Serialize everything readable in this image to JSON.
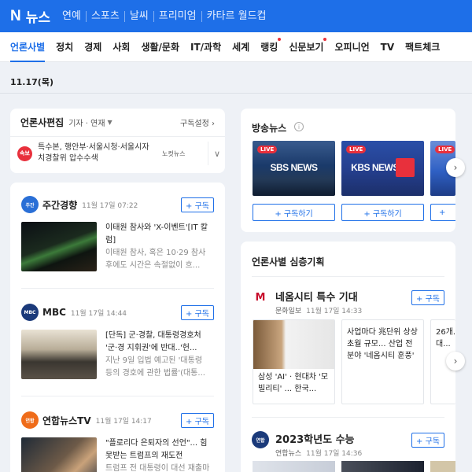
{
  "header": {
    "logo_letter": "N",
    "logo_text": "뉴스",
    "nav": [
      "연예",
      "스포츠",
      "날씨",
      "프리미엄",
      "카타르 월드컵"
    ]
  },
  "categories": [
    {
      "label": "언론사별",
      "active": true
    },
    {
      "label": "정치"
    },
    {
      "label": "경제"
    },
    {
      "label": "사회"
    },
    {
      "label": "생활/문화"
    },
    {
      "label": "IT/과학"
    },
    {
      "label": "세계"
    },
    {
      "label": "랭킹",
      "dot": true
    },
    {
      "label": "신문보기",
      "dot": true
    },
    {
      "label": "오피니언"
    },
    {
      "label": "TV"
    },
    {
      "label": "팩트체크"
    }
  ],
  "date": "11.17(목)",
  "press_edit": {
    "title": "언론사편집",
    "filter": "기자 · 연재",
    "manage": "구독설정",
    "badge": "속보",
    "headline": "특수본, 행안부·서울시청·서울시자치경찰위 압수수색",
    "source": "노컷뉴스"
  },
  "press_list": [
    {
      "name": "주간경향",
      "logo": "주간경향",
      "logo_color": "#2a6fd6",
      "time": "11월 17일 07:22",
      "subscribe": "+ 구독",
      "title": "이태원 참사와 'X-이벤트'[IT 칼럼]",
      "summary": "이태원 참사, 혹은 10·29 참사 후에도 시간은 속절없이 흐..."
    },
    {
      "name": "MBC",
      "logo": "MBC NEWS",
      "logo_color": "#1b3a7a",
      "time": "11월 17일 14:44",
      "subscribe": "+ 구독",
      "title": "[단독] 군·경찰, 대통령경호처 '군·경 지휘권'에 반대..'헌...",
      "summary": "지난 9일 입법 예고된 '대통령 등의 경호에 관한 법률'(대통..."
    },
    {
      "name": "연합뉴스TV",
      "logo": "연합뉴스TV",
      "logo_color": "#ef6c1a",
      "time": "11월 17일 14:17",
      "subscribe": "+ 구독",
      "title": "\"플로리다 은퇴자의 선언\"... 힘 못받는 트럼프의 재도전",
      "summary": "트럼프 전 대통령이 대선 재출마를 공식 선언했..."
    }
  ],
  "broadcast": {
    "title": "방송뉴스",
    "info": "i",
    "live": "LIVE",
    "subscribe": "+ 구독하기",
    "channels": [
      {
        "name": "SBS NEWS",
        "color": "#1a3a6a"
      },
      {
        "name": "KBS NEWS",
        "color": "#243e8c"
      },
      {
        "name": "",
        "color": "#2f60c4"
      }
    ]
  },
  "series": {
    "title": "언론사별 심층기획",
    "items": [
      {
        "name": "네옴시티 특수 기대",
        "logo": "M",
        "logo_color": "#c8102e",
        "press": "문화일보",
        "time": "11월 17일 14:33",
        "subscribe": "+ 구독",
        "articles": [
          {
            "text": "삼성 'AI' · 현대차 '모빌리티' ... 한국..."
          },
          {
            "text": "사업마다 兆단위 상상초월 규모... 산업 전 분야 '네옴시티 훈풍'"
          },
          {
            "text": "26개... 프로젝... 대..."
          }
        ]
      },
      {
        "name": "2023학년도 수능",
        "logo": "연합뉴스",
        "logo_color": "#1b3a7a",
        "press": "연합뉴스",
        "time": "11월 17일 14:36",
        "subscribe": "+ 구독"
      }
    ]
  },
  "colors": {
    "brand": "#1e6fe8",
    "red": "#e8303c",
    "bg": "#eef1f6"
  }
}
